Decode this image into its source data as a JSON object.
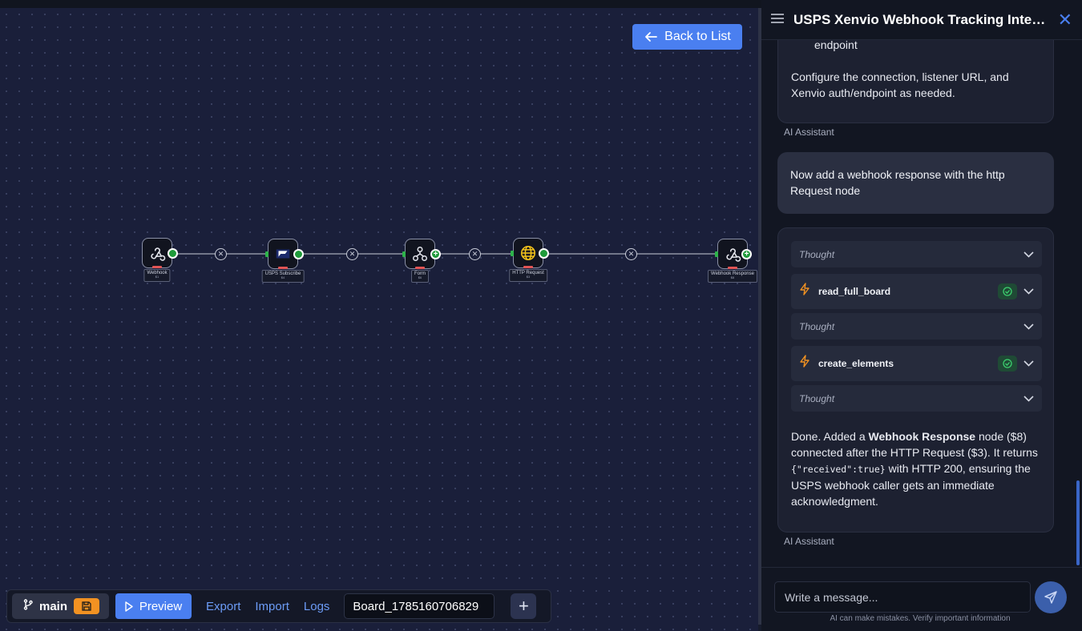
{
  "canvas": {
    "back_button": "Back to List",
    "nodes": [
      {
        "label": "Webhook",
        "id": "$1"
      },
      {
        "label": "USPS Subscribe",
        "id": "$4"
      },
      {
        "label": "Form",
        "id": "$6"
      },
      {
        "label": "HTTP Request",
        "id": "$3"
      },
      {
        "label": "Webhook Response",
        "id": "$8"
      }
    ]
  },
  "toolbar": {
    "branch": "main",
    "preview": "Preview",
    "export": "Export",
    "import": "Import",
    "logs": "Logs",
    "board_name": "Board_1785160706829"
  },
  "panel": {
    "title": "USPS Xenvio Webhook Tracking Integration",
    "messages": {
      "ai1_fragment": "endpoint",
      "ai1_text": "Configure the connection, listener URL, and Xenvio auth/endpoint as needed.",
      "ai_label": "AI Assistant",
      "user_text": "Now add a webhook response with the http Request node",
      "steps": {
        "thought": "Thought",
        "tool1": "read_full_board",
        "tool2": "create_elements"
      },
      "final": {
        "p1": "Done. Added a ",
        "bold": "Webhook Response",
        "p2": " node ($8) connected after the HTTP Request ($3). It returns ",
        "code": "{\"received\":true}",
        "p3": " with HTTP 200, ensuring the USPS webhook caller gets an immediate acknowledgment."
      }
    },
    "input_placeholder": "Write a message...",
    "disclaimer": "AI can make mistakes. Verify important information"
  },
  "colors": {
    "accent": "#4a7ff0",
    "canvas_bg": "#1a1f3a",
    "port_green": "#1f9b3a",
    "save_orange": "#f29222",
    "tool_bolt": "#f29222"
  }
}
